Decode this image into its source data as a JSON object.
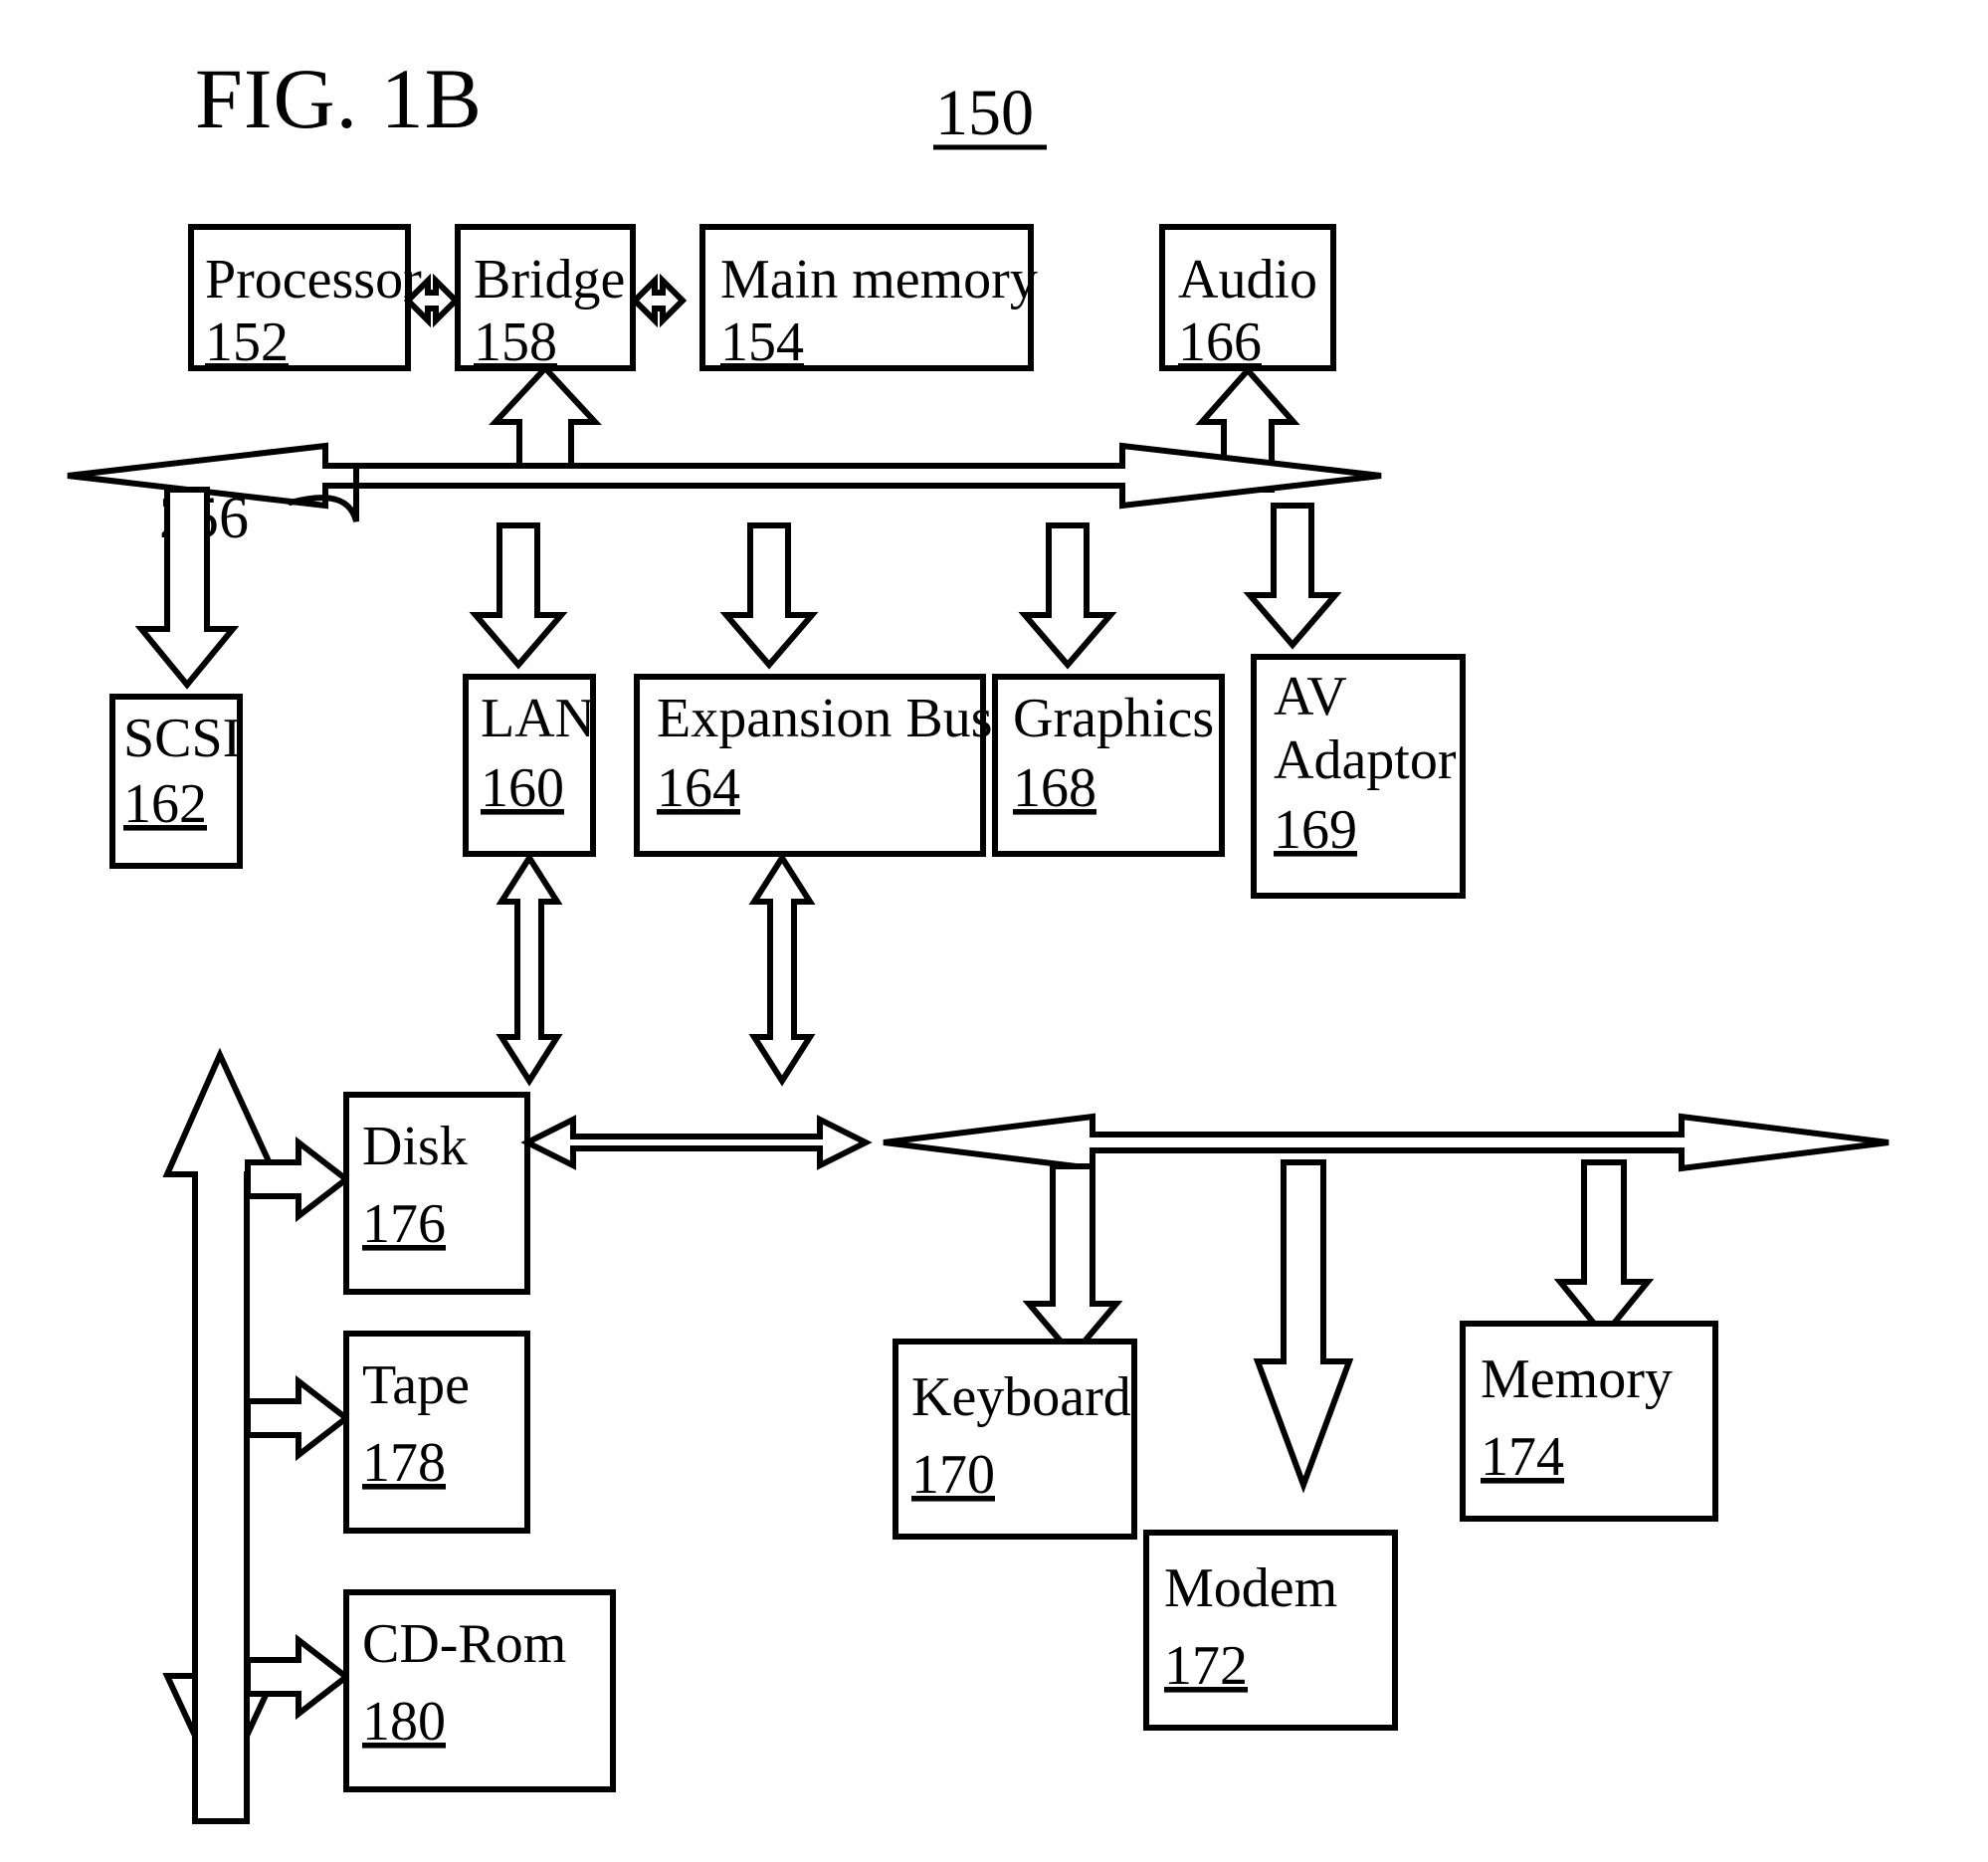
{
  "figure": {
    "title": "FIG. 1B",
    "reference_numeral": "150",
    "bus_label": "256"
  },
  "blocks": [
    {
      "id": "processor",
      "label": "Processor",
      "number": "152"
    },
    {
      "id": "bridge",
      "label": "Bridge",
      "number": "158"
    },
    {
      "id": "main_memory",
      "label": "Main memory",
      "number": "154"
    },
    {
      "id": "audio",
      "label": "Audio",
      "number": "166"
    },
    {
      "id": "lan",
      "label": "LAN",
      "number": "160"
    },
    {
      "id": "expansion",
      "label": "Expansion Bus",
      "number": "164"
    },
    {
      "id": "graphics",
      "label": "Graphics",
      "number": "168"
    },
    {
      "id": "av_adaptor",
      "label": "AV",
      "label2": "Adaptor",
      "number": "169"
    },
    {
      "id": "scsi",
      "label": "SCSI",
      "number": "162"
    },
    {
      "id": "disk",
      "label": "Disk",
      "number": "176"
    },
    {
      "id": "tape",
      "label": "Tape",
      "number": "178"
    },
    {
      "id": "cdrom",
      "label": "CD-Rom",
      "number": "180"
    },
    {
      "id": "keyboard",
      "label": "Keyboard",
      "number": "170"
    },
    {
      "id": "modem",
      "label": "Modem",
      "number": "172"
    },
    {
      "id": "memory",
      "label": "Memory",
      "number": "174"
    }
  ],
  "colors": {
    "ink": "#000000",
    "paper": "#ffffff"
  },
  "chart_data": {
    "type": "diagram",
    "title": "FIG. 1B",
    "diagram_ref": "150",
    "nodes": [
      "Processor 152",
      "Bridge 158",
      "Main memory 154",
      "Audio 166",
      "LAN 160",
      "Expansion Bus 164",
      "Graphics 168",
      "AV Adaptor 169",
      "SCSI 162",
      "Disk 176",
      "Tape 178",
      "CD-Rom 180",
      "Keyboard 170",
      "Modem 172",
      "Memory 174"
    ],
    "edges": [
      {
        "from": "Processor 152",
        "to": "Bridge 158",
        "style": "bidirectional"
      },
      {
        "from": "Bridge 158",
        "to": "Main memory 154",
        "style": "bidirectional"
      },
      {
        "from": "Bridge 158",
        "to": "System bus 256",
        "style": "up"
      },
      {
        "from": "System bus 256",
        "to": "Audio 166",
        "style": "up"
      },
      {
        "from": "System bus 256",
        "to": "SCSI 162",
        "style": "down"
      },
      {
        "from": "System bus 256",
        "to": "LAN 160",
        "style": "down"
      },
      {
        "from": "System bus 256",
        "to": "Expansion Bus 164",
        "style": "down"
      },
      {
        "from": "System bus 256",
        "to": "Graphics 168",
        "style": "down"
      },
      {
        "from": "System bus 256",
        "to": "AV Adaptor 169",
        "style": "down"
      },
      {
        "from": "SCSI 162",
        "to": "Disk 176",
        "style": "right"
      },
      {
        "from": "SCSI 162",
        "to": "Tape 178",
        "style": "right"
      },
      {
        "from": "SCSI 162",
        "to": "CD-Rom 180",
        "style": "right"
      },
      {
        "from": "LAN 160",
        "to": "Disk 176",
        "style": "bidirectional"
      },
      {
        "from": "Expansion Bus 164",
        "to": "Secondary bus",
        "style": "bidirectional"
      },
      {
        "from": "Secondary bus",
        "to": "Keyboard 170",
        "style": "down"
      },
      {
        "from": "Secondary bus",
        "to": "Modem 172",
        "style": "down"
      },
      {
        "from": "Secondary bus",
        "to": "Memory 174",
        "style": "down"
      }
    ]
  }
}
